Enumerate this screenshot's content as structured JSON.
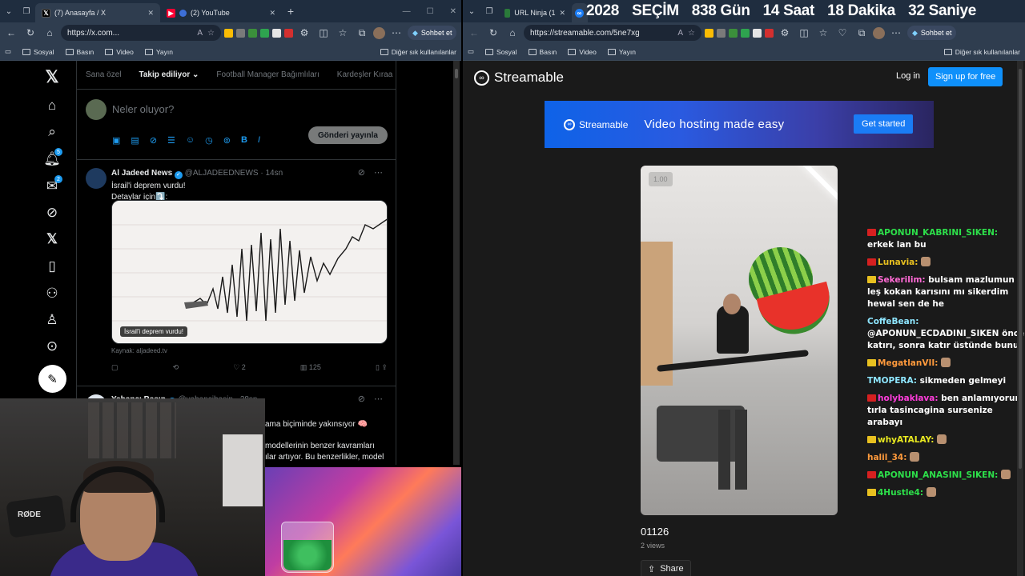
{
  "left_browser": {
    "tabs": [
      {
        "label": "(7) Anasayfa / X",
        "active": true
      },
      {
        "label": "(2) YouTube",
        "active": false
      }
    ],
    "url": "https://x.com...",
    "copilot_label": "Sohbet et",
    "favorites": [
      "Sosyal",
      "Basın",
      "Video",
      "Yayın"
    ],
    "other_favorites": "Diğer sık kullanılanlar"
  },
  "right_browser": {
    "tabs": [
      {
        "label": "URL Ninja (1",
        "active": false
      },
      {
        "label": "",
        "active": true
      }
    ],
    "url": "https://streamable.com/5ne7xg",
    "copilot_label": "Sohbet et",
    "favorites": [
      "Sosyal",
      "Basın",
      "Video",
      "Yayın"
    ],
    "other_favorites": "Diğer sık kullanılanlar"
  },
  "countdown_banner": [
    "2028",
    "SEÇİM",
    "838 Gün",
    "14 Saat",
    "18 Dakika",
    "32 Saniye"
  ],
  "x": {
    "badges": {
      "notifications": "5",
      "messages": "2"
    },
    "tabs": [
      "Sana özel",
      "Takip ediliyor",
      "Football Manager Bağımlıları",
      "Kardeşler Kıraa"
    ],
    "compose_placeholder": "Neler oluyor?",
    "publish_button": "Gönderi yayınla",
    "tweets": [
      {
        "name": "Al Jadeed News",
        "handle": "@ALJADEEDNEWS",
        "time": "14sn",
        "lines": [
          "İsrail'i deprem vurdu!",
          "Detaylar için⤵️:"
        ],
        "media_caption": "İsrail'i deprem vurdu!",
        "source": "Kaynak: aljadeed.tv",
        "likes": "2",
        "views": "125"
      },
      {
        "name": "Yabancı Basın",
        "handle": "@yabancibasin",
        "time": "28sn",
        "partial_lines": [
          "ama biçiminde yakınsıyor 🧠",
          "modellerinin benzer kavramları",
          "ılar artıyor. Bu benzerlikler, model"
        ]
      }
    ]
  },
  "streamable": {
    "logo": "Streamable",
    "login": "Log in",
    "signup": "Sign up for free",
    "ad": {
      "brand": "Streamable",
      "tagline": "Video hosting made easy",
      "cta": "Get started"
    },
    "player_speed": "1.00",
    "video_title": "01126",
    "views": "2 views",
    "share": "Share"
  },
  "chat": [
    {
      "user": "APONUN_KABRINI_SIKEN",
      "color": "#2de04a",
      "badge": "#d62020",
      "text": "erkek lan bu"
    },
    {
      "user": "Lunavia",
      "color": "#e8c020",
      "badge": "#d62020",
      "text": "",
      "emote": true
    },
    {
      "user": "Sekerilim",
      "color": "#ff6ad5",
      "badge": "#e8c020",
      "text": "bulsam mazlumun leş kokan karısını mı sikerdim hewal sen de he"
    },
    {
      "user": "CoffeBean",
      "color": "#8ee6ff",
      "badge": "",
      "text": "@APONUN_ECDADINI_SIKEN önce katırı, sonra katır üstünde bunu"
    },
    {
      "user": "MegatlanVII",
      "color": "#ff9a3c",
      "badge": "#e8c020",
      "text": "",
      "emote": true
    },
    {
      "user": "TMOPERA",
      "color": "#8ee6ff",
      "badge": "",
      "text": "sikmeden gelmeyi"
    },
    {
      "user": "holybaklava",
      "color": "#ff3ddb",
      "badge": "#d62020",
      "text": "ben anlamıyorum tırla tasincagina sursenize arabayı"
    },
    {
      "user": "whyATALAY",
      "color": "#e8e820",
      "badge": "#e8c020",
      "text": "",
      "emote": true
    },
    {
      "user": "halil_34",
      "color": "#ff9a3c",
      "badge": "",
      "text": "",
      "emote": true
    },
    {
      "user": "APONUN_ANASINI_SIKEN",
      "color": "#2de04a",
      "badge": "#d62020",
      "text": "",
      "emote": true
    },
    {
      "user": "4Hustle4",
      "color": "#2de04a",
      "badge": "#e8c020",
      "text": "",
      "emote": true
    }
  ]
}
